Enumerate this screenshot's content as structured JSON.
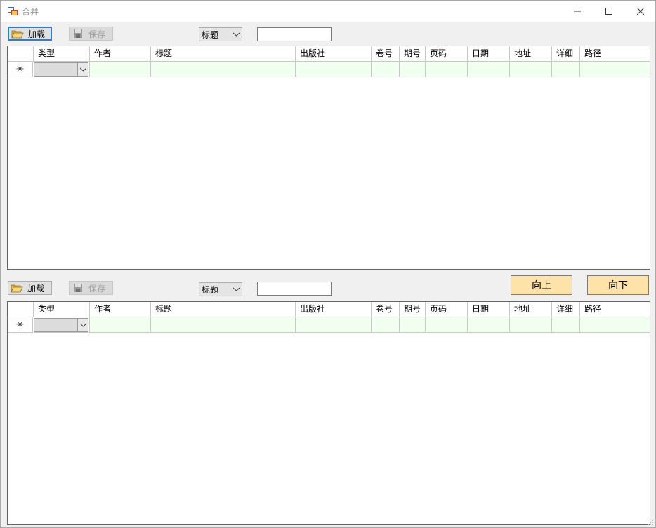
{
  "window": {
    "title": "合并",
    "minimize_label": "Minimize",
    "maximize_label": "Maximize",
    "close_label": "Close"
  },
  "panels": [
    {
      "load_label": "加载",
      "save_label": "保存",
      "field_select": "标题",
      "search_value": "",
      "columns": [
        "类型",
        "作者",
        "标题",
        "出版社",
        "卷号",
        "期号",
        "页码",
        "日期",
        "地址",
        "详细",
        "路径"
      ],
      "new_row_marker": "✳"
    },
    {
      "load_label": "加载",
      "save_label": "保存",
      "field_select": "标题",
      "search_value": "",
      "columns": [
        "类型",
        "作者",
        "标题",
        "出版社",
        "卷号",
        "期号",
        "页码",
        "日期",
        "地址",
        "详细",
        "路径"
      ],
      "new_row_marker": "✳"
    }
  ],
  "nav": {
    "up_label": "向上",
    "down_label": "向下"
  },
  "colors": {
    "button_accent": "#fde3a7",
    "new_row": "#f0fff0",
    "focus": "#2a7fd4"
  },
  "icons": [
    "open-folder-icon",
    "save-disk-icon",
    "chevron-down-icon",
    "close-icon",
    "app-icon"
  ]
}
